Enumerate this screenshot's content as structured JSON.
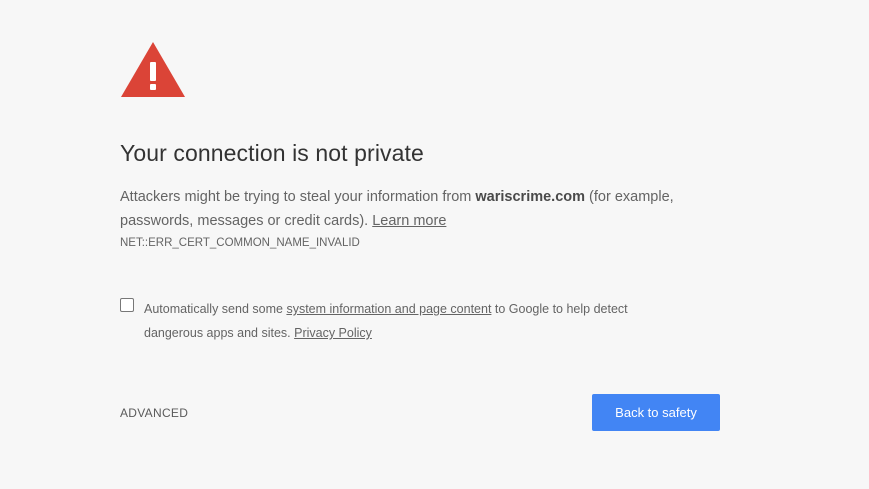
{
  "icon": "warning-triangle-icon",
  "colors": {
    "warning_red": "#db4437",
    "button_blue": "#4285f4",
    "background": "#f7f7f7"
  },
  "heading": "Your connection is not private",
  "main_message": {
    "prefix": "Attackers might be trying to steal your information from ",
    "domain": "wariscrime.com",
    "suffix": " (for example, passwords, messages or credit cards). ",
    "learn_more": "Learn more"
  },
  "error_code": "NET::ERR_CERT_COMMON_NAME_INVALID",
  "reporting": {
    "checked": false,
    "prefix": "Automatically send some ",
    "link": "system information and page content",
    "middle": " to Google to help detect dangerous apps and sites. ",
    "privacy_link": "Privacy Policy"
  },
  "advanced_label": "ADVANCED",
  "primary_button_label": "Back to safety"
}
